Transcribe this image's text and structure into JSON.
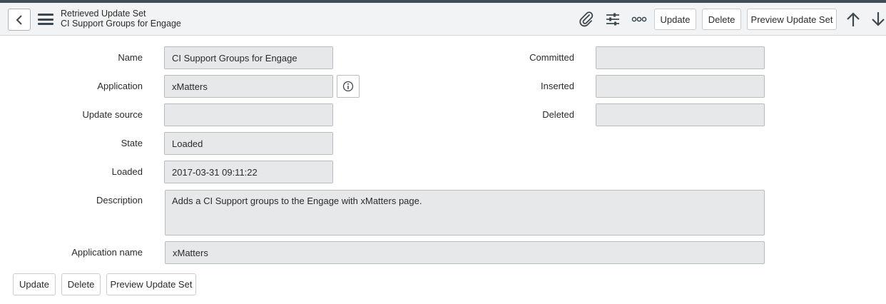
{
  "header": {
    "title_line1": "Retrieved Update Set",
    "title_line2": "CI Support Groups for Engage",
    "buttons": {
      "update": "Update",
      "delete": "Delete",
      "preview": "Preview Update Set"
    },
    "icons": [
      "back-icon",
      "menu-icon",
      "paperclip-icon",
      "settings-sliders-icon",
      "more-options-icon",
      "arrow-up-icon",
      "arrow-down-icon"
    ]
  },
  "form": {
    "name": {
      "label": "Name",
      "value": "CI  Support Groups for Engage"
    },
    "application": {
      "label": "Application",
      "value": "xMatters"
    },
    "update_source": {
      "label": "Update source",
      "value": ""
    },
    "state": {
      "label": "State",
      "value": "Loaded"
    },
    "loaded": {
      "label": "Loaded",
      "value": "2017-03-31 09:11:22"
    },
    "committed": {
      "label": "Committed",
      "value": ""
    },
    "inserted": {
      "label": "Inserted",
      "value": ""
    },
    "deleted": {
      "label": "Deleted",
      "value": ""
    },
    "description": {
      "label": "Description",
      "value": "Adds a CI Support groups to the Engage with xMatters page."
    },
    "application_name": {
      "label": "Application name",
      "value": "xMatters"
    }
  },
  "footer": {
    "buttons": {
      "update": "Update",
      "delete": "Delete",
      "preview": "Preview Update Set"
    }
  },
  "colors": {
    "header_bg": "#f2f3f4",
    "top_strip": "#414c57",
    "field_bg": "#e7e8e9",
    "field_border": "#b7bcc0"
  }
}
